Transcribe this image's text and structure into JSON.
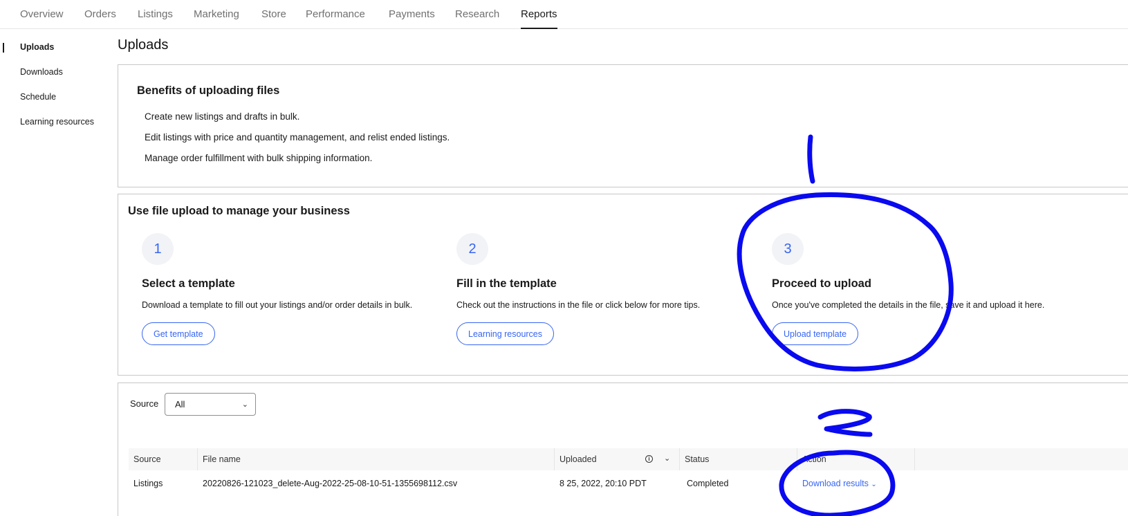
{
  "topnav": {
    "tabs": [
      {
        "label": "Overview"
      },
      {
        "label": "Orders"
      },
      {
        "label": "Listings"
      },
      {
        "label": "Marketing"
      },
      {
        "label": "Store"
      },
      {
        "label": "Performance"
      },
      {
        "label": "Payments"
      },
      {
        "label": "Research"
      },
      {
        "label": "Reports",
        "active": true
      }
    ]
  },
  "sidebar": {
    "items": [
      {
        "label": "Uploads",
        "active": true
      },
      {
        "label": "Downloads"
      },
      {
        "label": "Schedule"
      },
      {
        "label": "Learning resources"
      }
    ]
  },
  "page": {
    "title": "Uploads"
  },
  "benefits": {
    "title": "Benefits of uploading files",
    "lines": [
      "Create new listings and drafts in bulk.",
      "Edit listings with price and quantity management, and relist ended listings.",
      "Manage order fulfillment with bulk shipping information."
    ]
  },
  "steps": {
    "title": "Use file upload to manage your business",
    "items": [
      {
        "number": "1",
        "title": "Select a template",
        "desc": "Download a template to fill out your listings and/or order details in bulk.",
        "button": "Get template"
      },
      {
        "number": "2",
        "title": "Fill in the template",
        "desc": "Check out the instructions in the file or click below for more tips.",
        "button": "Learning resources"
      },
      {
        "number": "3",
        "title": "Proceed to upload",
        "desc": "Once you've completed the details in the file, save it and upload it here.",
        "button": "Upload template"
      }
    ]
  },
  "filter": {
    "label": "Source",
    "value": "All"
  },
  "table": {
    "headers": [
      "Source",
      "File name",
      "Uploaded",
      "Status",
      "Action"
    ],
    "rows": [
      {
        "source": "Listings",
        "file_name": "20220826-121023_delete-Aug-2022-25-08-10-51-1355698112.csv",
        "uploaded": "8 25, 2022, 20:10 PDT",
        "status": "Completed",
        "action": "Download results"
      }
    ]
  },
  "annotations": {
    "color": "#0a0af0",
    "labels": [
      "1",
      "2"
    ]
  },
  "colors": {
    "accent": "#3665f3",
    "text": "#191919",
    "muted": "#707070"
  }
}
